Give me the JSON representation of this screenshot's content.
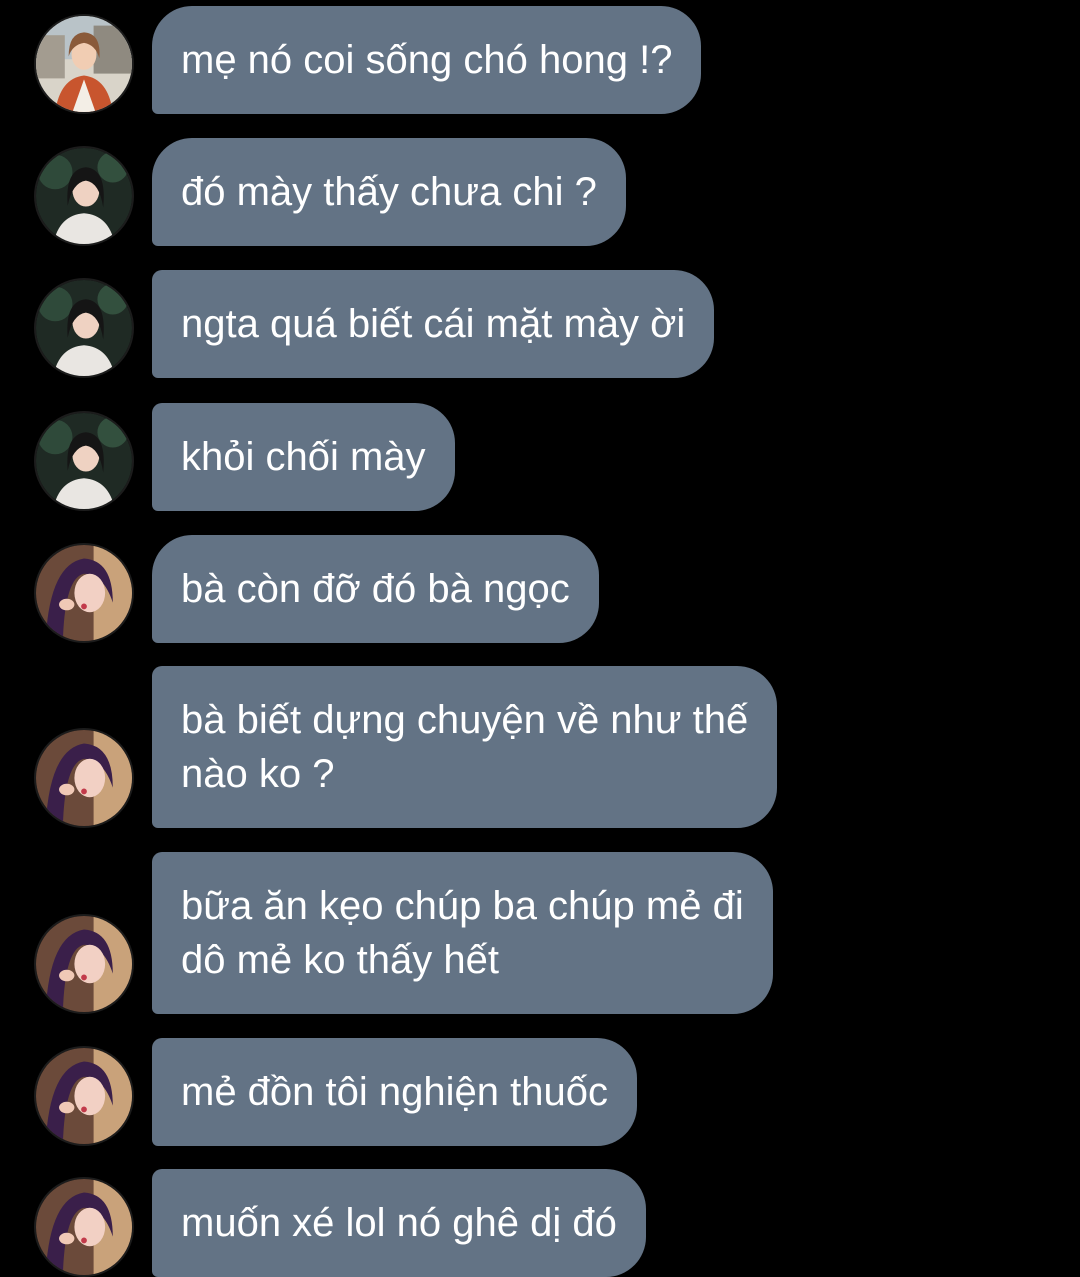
{
  "chat": {
    "messages": [
      {
        "sender": "user-a",
        "avatar_icon": "avatar-icon",
        "text": "mẹ nó coi sống chó hong !?"
      },
      {
        "sender": "user-b",
        "avatar_icon": "avatar-icon",
        "text": "đó mày thấy chưa chi ?"
      },
      {
        "sender": "user-b",
        "avatar_icon": "avatar-icon",
        "text": "ngta quá biết cái mặt mày ời"
      },
      {
        "sender": "user-b",
        "avatar_icon": "avatar-icon",
        "text": "khỏi chối mày"
      },
      {
        "sender": "user-c",
        "avatar_icon": "avatar-icon",
        "text": "bà còn đỡ đó bà ngọc"
      },
      {
        "sender": "user-c",
        "avatar_icon": "avatar-icon",
        "text": "bà biết dựng chuyện về như thế\nnào ko ?"
      },
      {
        "sender": "user-c",
        "avatar_icon": "avatar-icon",
        "text": "bữa ăn kẹo chúp ba chúp mẻ đi\ndô mẻ ko thấy hết"
      },
      {
        "sender": "user-c",
        "avatar_icon": "avatar-icon",
        "text": "mẻ đồn tôi nghiện thuốc"
      },
      {
        "sender": "user-c",
        "avatar_icon": "avatar-icon",
        "text": "muốn xé lol nó ghê dị đó"
      }
    ]
  },
  "colors": {
    "background": "#000000",
    "bubble": "#637385",
    "bubble_text": "#ffffff"
  }
}
